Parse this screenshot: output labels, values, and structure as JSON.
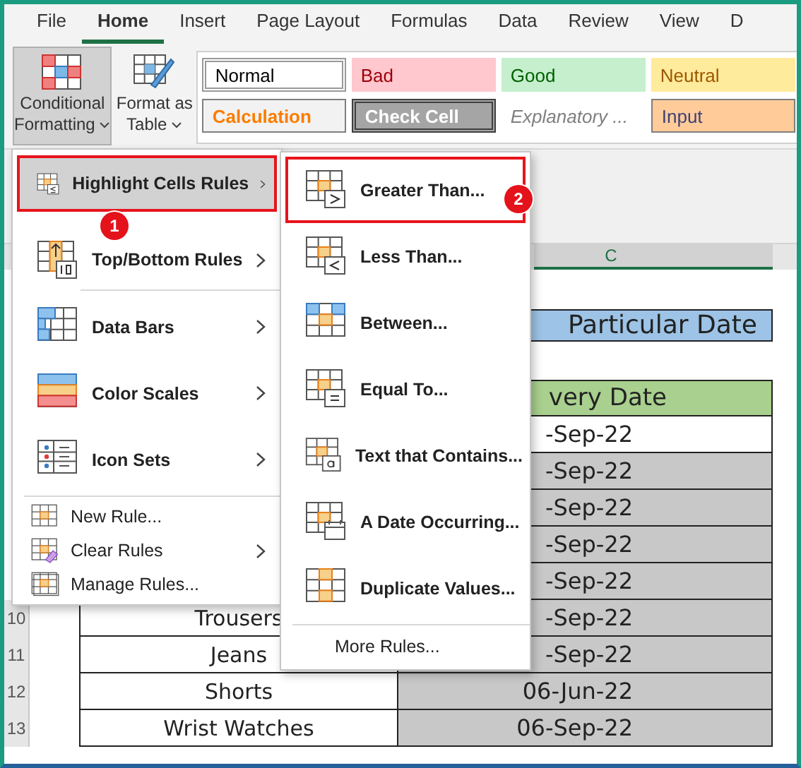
{
  "tabs": [
    {
      "label": "File",
      "selected": false
    },
    {
      "label": "Home",
      "selected": true
    },
    {
      "label": "Insert",
      "selected": false
    },
    {
      "label": "Page Layout",
      "selected": false
    },
    {
      "label": "Formulas",
      "selected": false
    },
    {
      "label": "Data",
      "selected": false
    },
    {
      "label": "Review",
      "selected": false
    },
    {
      "label": "View",
      "selected": false
    },
    {
      "label": "D",
      "selected": false
    }
  ],
  "ribbon": {
    "buttons": [
      {
        "kind": "conditional",
        "lines": [
          "Conditional",
          "Formatting"
        ],
        "pressed": true
      },
      {
        "kind": "table",
        "lines": [
          "Format as",
          "Table"
        ],
        "pressed": false
      }
    ],
    "cell_styles": [
      {
        "label": "Normal",
        "kind": "normal"
      },
      {
        "label": "Bad",
        "kind": "bad"
      },
      {
        "label": "Good",
        "kind": "good"
      },
      {
        "label": "Neutral",
        "kind": "neutral"
      },
      {
        "label": "Calculation",
        "kind": "calculation"
      },
      {
        "label": "Check Cell",
        "kind": "check"
      },
      {
        "label": "Explanatory ...",
        "kind": "explanatory"
      },
      {
        "label": "Input",
        "kind": "input"
      }
    ]
  },
  "sheet": {
    "column_header": "C",
    "title": "Particular Date",
    "header": "very Date",
    "rows": [
      {
        "date": "-Sep-22",
        "highlighted": false
      },
      {
        "date": "-Sep-22",
        "highlighted": true
      },
      {
        "date": "-Sep-22",
        "highlighted": true
      },
      {
        "date": "-Sep-22",
        "highlighted": true
      },
      {
        "date": "-Sep-22",
        "highlighted": true
      },
      {
        "row_number": "10",
        "item": "Trousers",
        "date": "-Sep-22",
        "highlighted": true
      },
      {
        "row_number": "11",
        "item": "Jeans",
        "date": "-Sep-22",
        "highlighted": true
      },
      {
        "row_number": "12",
        "item": "Shorts",
        "date": "06-Jun-22",
        "highlighted": true
      },
      {
        "row_number": "13",
        "item": "Wrist Watches",
        "date": "06-Sep-22",
        "highlighted": true
      }
    ]
  },
  "menu": {
    "sections": [
      {
        "items": [
          {
            "label": "Highlight Cells Rules",
            "kind": "highlight",
            "submenu": true,
            "open": true,
            "selected": true
          },
          {
            "label": "Top/Bottom Rules",
            "kind": "topbottom",
            "submenu": true,
            "open": false,
            "selected": false
          }
        ]
      },
      {
        "items": [
          {
            "label": "Data Bars",
            "kind": "databars",
            "submenu": true,
            "open": false,
            "selected": false
          },
          {
            "label": "Color Scales",
            "kind": "colorscales",
            "submenu": true,
            "open": false,
            "selected": false
          },
          {
            "label": "Icon Sets",
            "kind": "iconsets",
            "submenu": true,
            "open": false,
            "selected": false
          }
        ]
      },
      {
        "items": [
          {
            "label": "New Rule...",
            "kind": "newrule",
            "submenu": false,
            "open": false,
            "selected": false
          },
          {
            "label": "Clear Rules",
            "kind": "clearrules",
            "submenu": true,
            "open": false,
            "selected": false
          },
          {
            "label": "Manage Rules...",
            "kind": "managerules",
            "submenu": false,
            "open": false,
            "selected": false
          }
        ]
      }
    ]
  },
  "submenu": {
    "sections": [
      {
        "items": [
          {
            "label": "Greater Than...",
            "kind": "greater",
            "selected": true
          },
          {
            "label": "Less Than...",
            "kind": "less",
            "selected": false
          },
          {
            "label": "Between...",
            "kind": "between",
            "selected": false
          },
          {
            "label": "Equal To...",
            "kind": "equal",
            "selected": false
          },
          {
            "label": "Text that Contains...",
            "kind": "text",
            "selected": false
          },
          {
            "label": "A Date Occurring...",
            "kind": "date",
            "selected": false
          },
          {
            "label": "Duplicate Values...",
            "kind": "duplicate",
            "selected": false
          }
        ]
      },
      {
        "items": [
          {
            "label": "More Rules...",
            "kind": "none",
            "selected": false
          }
        ]
      }
    ]
  },
  "badges": [
    "1",
    "2"
  ]
}
